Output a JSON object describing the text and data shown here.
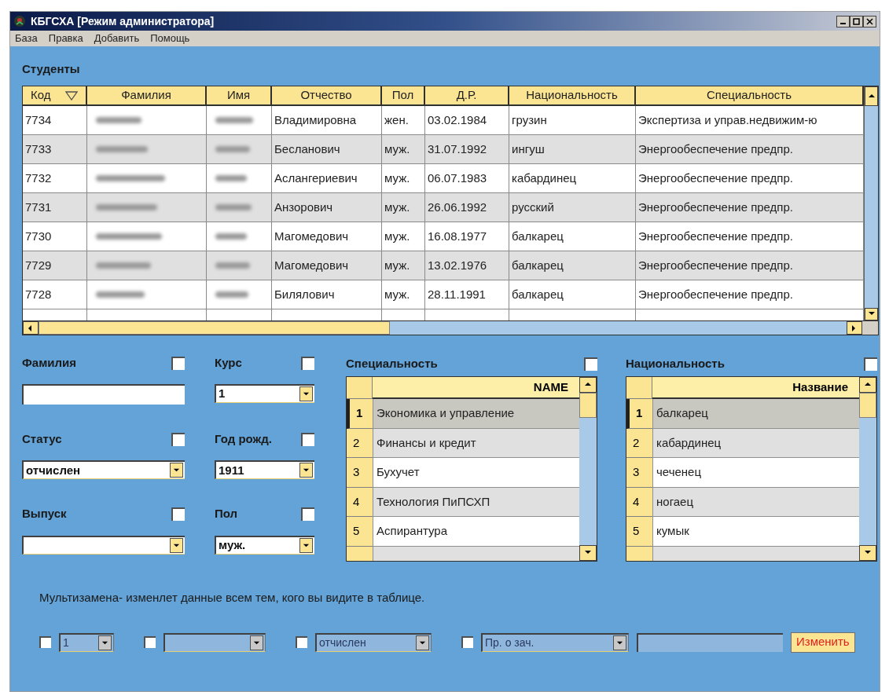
{
  "window": {
    "title": "КБГСХА [Режим администратора]"
  },
  "menu": [
    "База",
    "Правка",
    "Добавить",
    "Помощь"
  ],
  "students": {
    "title": "Студенты",
    "columns": [
      {
        "label": "Код",
        "sorted": true
      },
      {
        "label": "Фамилия",
        "sorted": false
      },
      {
        "label": "Имя",
        "sorted": false
      },
      {
        "label": "Отчество",
        "sorted": false
      },
      {
        "label": "Пол",
        "sorted": false
      },
      {
        "label": "Д.Р.",
        "sorted": false
      },
      {
        "label": "Национальность",
        "sorted": false
      },
      {
        "label": "Специальность",
        "sorted": false
      }
    ],
    "rows": [
      {
        "code": "7734",
        "patronymic": "Владимировна",
        "gender": "жен.",
        "birth_date": "03.02.1984",
        "nationality": "грузин",
        "specialty": "Экспертиза и управ.недвижим-ю"
      },
      {
        "code": "7733",
        "patronymic": "Бесланович",
        "gender": "муж.",
        "birth_date": "31.07.1992",
        "nationality": "ингуш",
        "specialty": "Энергообеспечение предпр."
      },
      {
        "code": "7732",
        "patronymic": "Аслангериевич",
        "gender": "муж.",
        "birth_date": "06.07.1983",
        "nationality": "кабардинец",
        "specialty": "Энергообеспечение предпр."
      },
      {
        "code": "7731",
        "patronymic": "Анзорович",
        "gender": "муж.",
        "birth_date": "26.06.1992",
        "nationality": "русский",
        "specialty": "Энергообеспечение предпр."
      },
      {
        "code": "7730",
        "patronymic": "Магомедович",
        "gender": "муж.",
        "birth_date": "16.08.1977",
        "nationality": "балкарец",
        "specialty": "Энергообеспечение предпр."
      },
      {
        "code": "7729",
        "patronymic": "Магомедович",
        "gender": "муж.",
        "birth_date": "13.02.1976",
        "nationality": "балкарец",
        "specialty": "Энергообеспечение предпр."
      },
      {
        "code": "7728",
        "patronymic": "Билялович",
        "gender": "муж.",
        "birth_date": "28.11.1991",
        "nationality": "балкарец",
        "specialty": "Энергообеспечение предпр."
      }
    ]
  },
  "filters": [
    {
      "kind": "text",
      "label": "Фамилия",
      "checked": false
    },
    {
      "kind": "select",
      "label": "Курс",
      "checked": false,
      "value": "1"
    },
    {
      "kind": "select",
      "label": "Статус",
      "checked": false,
      "value": "отчислен"
    },
    {
      "kind": "select",
      "label": "Год рожд.",
      "checked": false,
      "value": "1911"
    },
    {
      "kind": "select",
      "label": "Выпуск",
      "checked": false
    },
    {
      "kind": "select",
      "label": "Пол",
      "checked": false,
      "value": "муж."
    }
  ],
  "lists": [
    {
      "title": "Специальность",
      "checked": false,
      "column": "NAME",
      "rows": [
        {
          "number": "1",
          "name": "Экономика и управление",
          "selected": true
        },
        {
          "number": "2",
          "name": "Финансы и кредит",
          "selected": false
        },
        {
          "number": "3",
          "name": "Бухучет",
          "selected": false
        },
        {
          "number": "4",
          "name": "Технология ПиПСХП",
          "selected": false
        },
        {
          "number": "5",
          "name": "Аспирантура",
          "selected": false
        }
      ]
    },
    {
      "title": "Национальность",
      "checked": false,
      "column": "Название",
      "rows": [
        {
          "number": "1",
          "name": "балкарец",
          "selected": true
        },
        {
          "number": "2",
          "name": "кабардинец",
          "selected": false
        },
        {
          "number": "3",
          "name": "чеченец",
          "selected": false
        },
        {
          "number": "4",
          "name": "ногаец",
          "selected": false
        },
        {
          "number": "5",
          "name": "кумык",
          "selected": false
        }
      ]
    }
  ],
  "multi": {
    "note": "Мультизамена- изменлет данные всем тем, кого вы видите в таблице.",
    "controls": [
      {
        "checked": false,
        "value": "1"
      },
      {
        "checked": false
      },
      {
        "checked": false,
        "value": "отчислен"
      },
      {
        "checked": false,
        "value": "Пр. о зач."
      }
    ],
    "button": "Изменить"
  }
}
